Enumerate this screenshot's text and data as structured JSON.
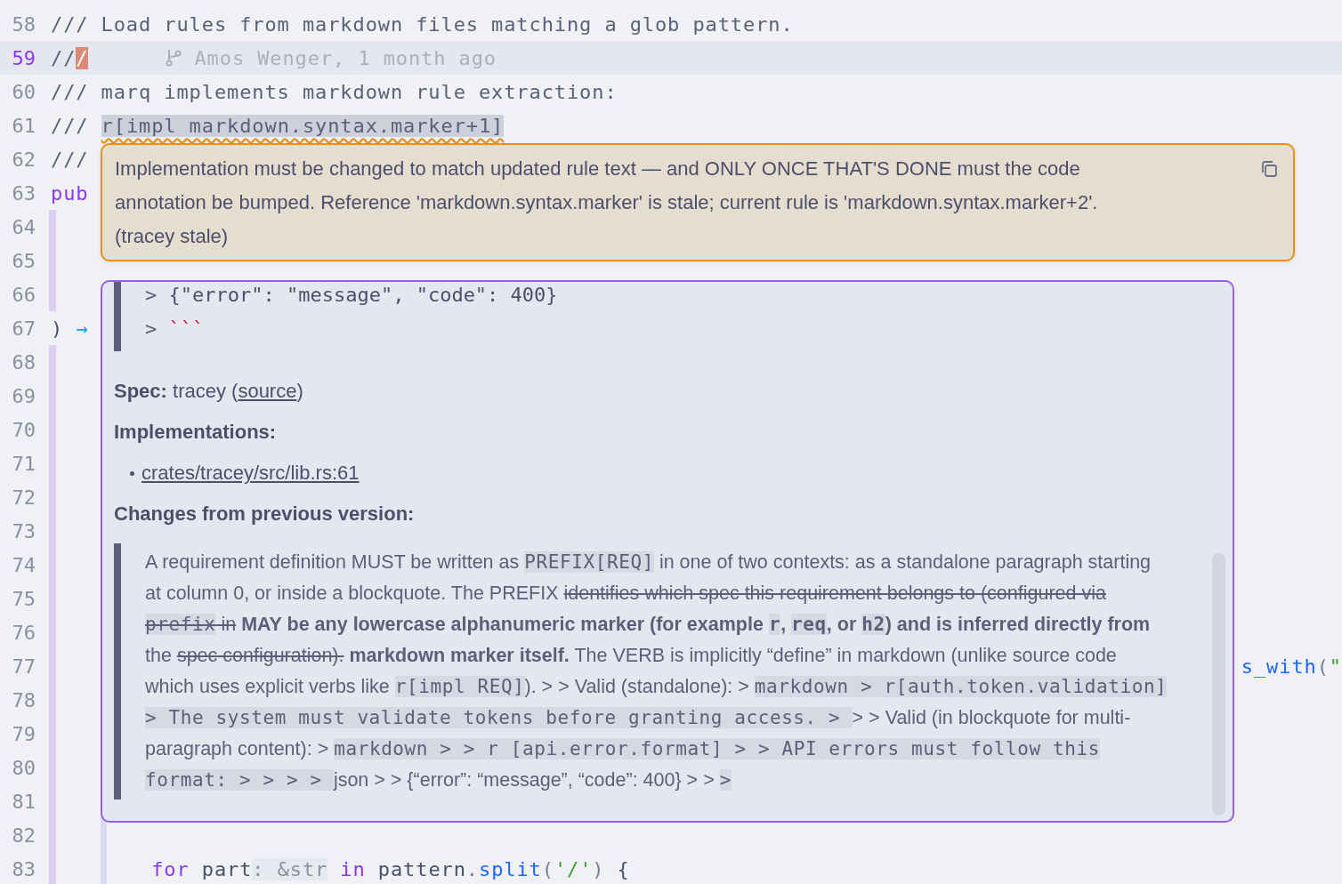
{
  "editor": {
    "lines": [
      {
        "number": "58",
        "current": false,
        "scope": false,
        "guide": false,
        "kind": "normal",
        "tokens": [
          {
            "kind": "comment",
            "text": "/// Load rules from markdown files matching a glob pattern."
          }
        ]
      },
      {
        "number": "59",
        "current": true,
        "scope": false,
        "guide": false,
        "kind": "normal",
        "tokens": [
          {
            "kind": "comment",
            "text": "//"
          },
          {
            "kind": "cursor",
            "text": "/"
          }
        ],
        "blame": "Amos Wenger, 1 month ago"
      },
      {
        "number": "60",
        "current": false,
        "scope": false,
        "guide": false,
        "kind": "normal",
        "tokens": [
          {
            "kind": "comment",
            "text": "/// marq implements markdown rule extraction:"
          }
        ]
      },
      {
        "number": "61",
        "current": false,
        "scope": false,
        "guide": false,
        "kind": "normal",
        "tokens": [
          {
            "kind": "comment",
            "text": "/// "
          },
          {
            "kind": "flagged",
            "text": "r[impl markdown.syntax.marker+1]"
          }
        ]
      },
      {
        "number": "62",
        "current": false,
        "scope": false,
        "guide": false,
        "kind": "normal",
        "tokens": [
          {
            "kind": "comment",
            "text": "///"
          }
        ]
      },
      {
        "number": "63",
        "current": false,
        "scope": false,
        "guide": false,
        "kind": "normal",
        "tokens": [
          {
            "kind": "keyword",
            "text": "pub"
          }
        ]
      },
      {
        "number": "64",
        "current": false,
        "scope": true,
        "guide": false,
        "kind": "normal"
      },
      {
        "number": "65",
        "current": false,
        "scope": true,
        "guide": false,
        "kind": "normal"
      },
      {
        "number": "66",
        "current": false,
        "scope": true,
        "guide": false,
        "kind": "normal"
      },
      {
        "number": "67",
        "current": false,
        "scope": false,
        "guide": false,
        "kind": "normal",
        "tokens": [
          {
            "kind": "plain",
            "text": ") "
          },
          {
            "kind": "arrow",
            "text": "→"
          }
        ]
      },
      {
        "number": "68",
        "current": false,
        "scope": true,
        "guide": false,
        "kind": "normal"
      },
      {
        "number": "69",
        "current": false,
        "scope": true,
        "guide": false,
        "kind": "normal"
      },
      {
        "number": "70",
        "current": false,
        "scope": true,
        "guide": false,
        "kind": "normal"
      },
      {
        "number": "71",
        "current": false,
        "scope": true,
        "guide": false,
        "kind": "normal"
      },
      {
        "number": "72",
        "current": false,
        "scope": true,
        "guide": false,
        "kind": "normal"
      },
      {
        "number": "73",
        "current": false,
        "scope": true,
        "guide": false,
        "kind": "normal"
      },
      {
        "number": "74",
        "current": false,
        "scope": true,
        "guide": false,
        "kind": "normal"
      },
      {
        "number": "75",
        "current": false,
        "scope": true,
        "guide": false,
        "kind": "normal"
      },
      {
        "number": "76",
        "current": false,
        "scope": true,
        "guide": false,
        "kind": "normal"
      },
      {
        "number": "77",
        "current": false,
        "scope": true,
        "guide": false,
        "kind": "tail",
        "tokens": [
          {
            "kind": "fn",
            "text": "s_with"
          },
          {
            "kind": "punct",
            "text": "("
          },
          {
            "kind": "string",
            "text": "\""
          }
        ]
      },
      {
        "number": "78",
        "current": false,
        "scope": true,
        "guide": false,
        "kind": "normal"
      },
      {
        "number": "79",
        "current": false,
        "scope": true,
        "guide": false,
        "kind": "normal"
      },
      {
        "number": "80",
        "current": false,
        "scope": true,
        "guide": false,
        "kind": "normal"
      },
      {
        "number": "81",
        "current": false,
        "scope": true,
        "guide": false,
        "kind": "normal"
      },
      {
        "number": "82",
        "current": false,
        "scope": true,
        "guide": true,
        "kind": "normal"
      },
      {
        "number": "83",
        "current": false,
        "scope": true,
        "guide": true,
        "kind": "normal",
        "tokens": [
          {
            "kind": "keyword",
            "text": "        for"
          },
          {
            "kind": "plain",
            "text": " part"
          },
          {
            "kind": "inlay",
            "text": ": &str"
          },
          {
            "kind": "keyword",
            "text": " in"
          },
          {
            "kind": "plain",
            "text": " pattern"
          },
          {
            "kind": "punct",
            "text": "."
          },
          {
            "kind": "fn",
            "text": "split"
          },
          {
            "kind": "punct",
            "text": "("
          },
          {
            "kind": "string",
            "text": "'/'"
          },
          {
            "kind": "punct",
            "text": ")"
          },
          {
            "kind": "plain",
            "text": " {"
          }
        ]
      }
    ]
  },
  "diagnostic": {
    "message": "Implementation must be changed to match updated rule text — and ONLY ONCE THAT'S DONE must the code annotation be bumped. Reference 'markdown.syntax.marker' is stale; current rule is 'markdown.syntax.marker+2'.",
    "source": "(tracey stale)"
  },
  "hover": {
    "quote_lines": [
      [
        {
          "kind": "prompt",
          "text": "> "
        },
        {
          "kind": "plain",
          "text": "{\"error\": \"message\", \"code\": 400}"
        }
      ],
      [
        {
          "kind": "prompt",
          "text": "> "
        },
        {
          "kind": "fence",
          "text": "```"
        }
      ]
    ],
    "spec": {
      "label": "Spec:",
      "before": " tracey (",
      "link": "source",
      "after": ")"
    },
    "implementations": {
      "heading": "Implementations:",
      "items": [
        "crates/tracey/src/lib.rs:61"
      ]
    },
    "changes": {
      "heading": "Changes from previous version:",
      "segments": [
        {
          "kind": "text",
          "text": "A requirement definition MUST be written as "
        },
        {
          "kind": "code",
          "text": "PREFIX[REQ]"
        },
        {
          "kind": "text",
          "text": " in one of two contexts: as a standalone paragraph starting at column 0, or inside a blockquote. The PREFIX "
        },
        {
          "kind": "del",
          "text": "identifies which spec this requirement belongs to (configured via "
        },
        {
          "kind": "del_code",
          "text": "prefix"
        },
        {
          "kind": "del",
          "text": " in"
        },
        {
          "kind": "bold",
          "text": " MAY be any lowercase alphanumeric marker (for example "
        },
        {
          "kind": "bold_code",
          "text": "r"
        },
        {
          "kind": "bold",
          "text": ", "
        },
        {
          "kind": "bold_code",
          "text": "req"
        },
        {
          "kind": "bold",
          "text": ", or "
        },
        {
          "kind": "bold_code",
          "text": "h2"
        },
        {
          "kind": "bold",
          "text": ") and is inferred directly from"
        },
        {
          "kind": "text",
          "text": " the "
        },
        {
          "kind": "del",
          "text": "spec configuration)."
        },
        {
          "kind": "bold",
          "text": " markdown marker itself."
        },
        {
          "kind": "text",
          "text": " The VERB is implicitly “define” in markdown (unlike source code which uses explicit verbs like "
        },
        {
          "kind": "code",
          "text": "r[impl REQ]"
        },
        {
          "kind": "text",
          "text": "). > > Valid (standalone): > "
        },
        {
          "kind": "code",
          "text": "markdown > r[auth.token.validation] > The system must validate tokens before granting access. > "
        },
        {
          "kind": "text",
          "text": " > > Valid (in blockquote for multi-paragraph content): > "
        },
        {
          "kind": "code",
          "text": "markdown > > r [api.error.format] > > API errors must follow this format: > > > > "
        },
        {
          "kind": "text",
          "text": "json > > {“error”: “message”, “code”: 400} > > "
        },
        {
          "kind": "code",
          "text": " > "
        }
      ]
    }
  }
}
